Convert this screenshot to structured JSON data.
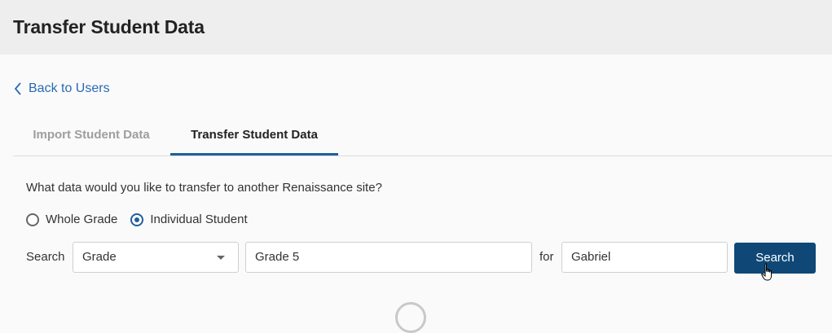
{
  "header": {
    "title": "Transfer Student Data"
  },
  "back_link": {
    "label": "Back to Users",
    "icon": "chevron-left-icon"
  },
  "tabs": [
    {
      "label": "Import Student Data",
      "active": false
    },
    {
      "label": "Transfer Student Data",
      "active": true
    }
  ],
  "form": {
    "question": "What data would you like to transfer to another Renaissance site?",
    "radio_options": [
      {
        "label": "Whole Grade",
        "checked": false
      },
      {
        "label": "Individual Student",
        "checked": true
      }
    ],
    "search_label": "Search",
    "search_by_select": {
      "value": "Grade"
    },
    "grade_input": {
      "value": "Grade 5"
    },
    "for_label": "for",
    "name_input": {
      "value": "Gabriel"
    },
    "search_button": {
      "label": "Search"
    }
  },
  "colors": {
    "accent": "#0f4877",
    "link": "#2a6ab4",
    "header_bg": "#eeeeee"
  }
}
